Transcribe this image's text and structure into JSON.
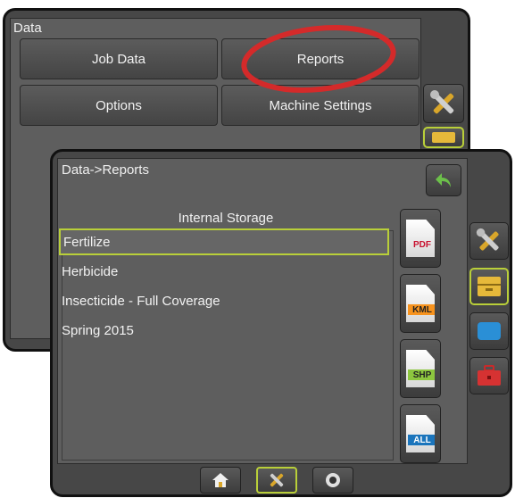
{
  "back_screen": {
    "title": "Data",
    "buttons": {
      "job_data": "Job Data",
      "reports": "Reports",
      "options": "Options",
      "machine_settings": "Machine Settings"
    }
  },
  "front_screen": {
    "breadcrumb": "Data->Reports",
    "storage_heading": "Internal Storage",
    "reports": [
      "Fertilize",
      "Herbicide",
      "Insecticide - Full Coverage",
      "Spring 2015"
    ],
    "selected_index": 0,
    "export_formats": [
      "PDF",
      "KML",
      "SHP",
      "ALL"
    ]
  },
  "colors": {
    "screen_bg": "#474747",
    "panel_bg": "#5e5e5e",
    "selection": "#b9cf39",
    "annotation_circle": "#d42a2a",
    "pdf_tag": "#c8102e",
    "kml_tag": "#f7931e",
    "shp_tag": "#8dc63f",
    "all_tag": "#1b75bc"
  },
  "icons": [
    "back-arrow-icon",
    "tools-icon",
    "data-drawer-icon",
    "display-icon",
    "toolbox-icon",
    "home-icon",
    "camera-icon"
  ]
}
